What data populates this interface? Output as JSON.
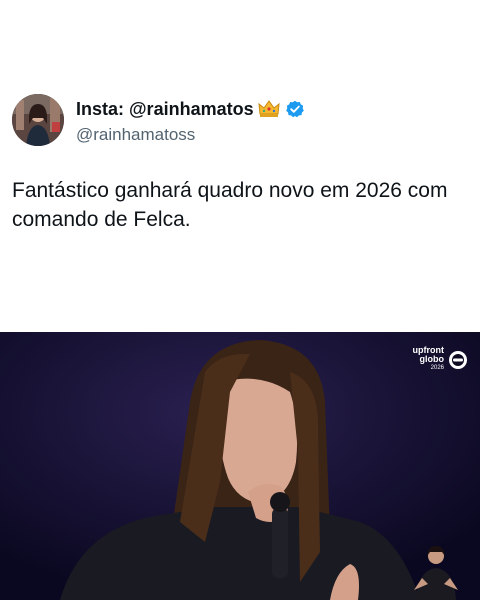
{
  "post": {
    "display_name": "Insta: @rainhamatos",
    "handle": "@rainhamatoss",
    "text": "Fantástico ganhará quadro novo em 2026 com comando de Felca.",
    "icons": {
      "crown": "crown-icon",
      "verified": "verified-badge-icon",
      "avatar": "avatar-photo"
    }
  },
  "video": {
    "watermark": {
      "line1": "upfront",
      "line2": "globo",
      "year": "2026"
    },
    "icons": {
      "logo": "globo-logo-icon",
      "interpreter": "sign-language-interpreter"
    }
  },
  "colors": {
    "text": "#0f1419",
    "secondary": "#536471",
    "verified": "#1d9bf0",
    "stage": "#0d0a22"
  }
}
